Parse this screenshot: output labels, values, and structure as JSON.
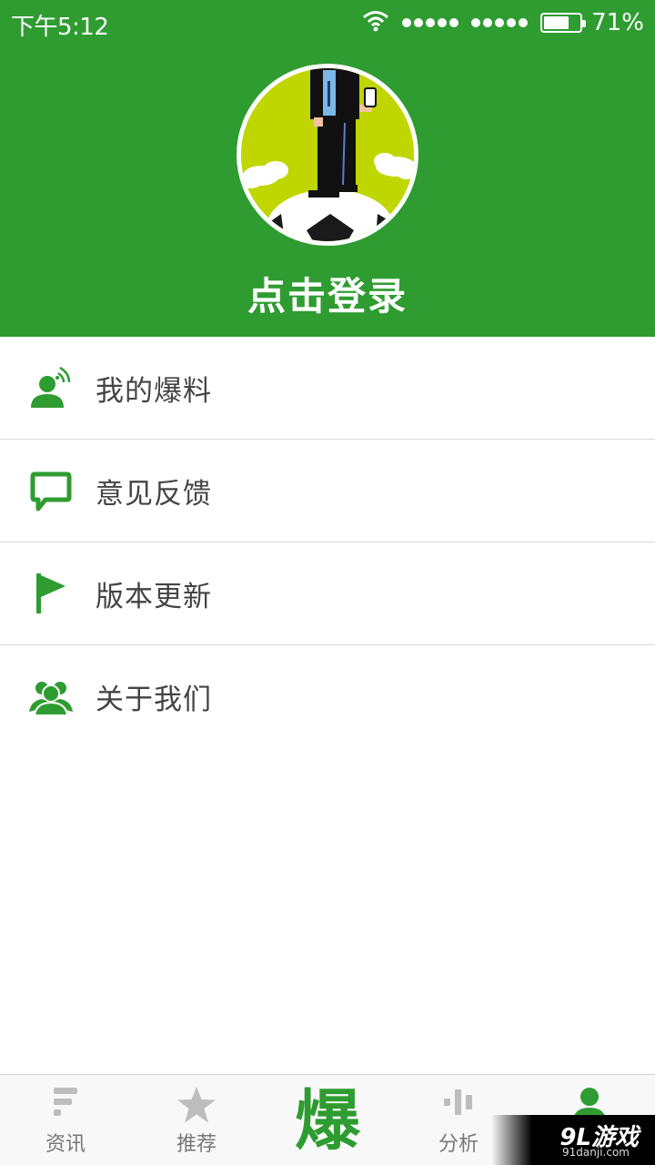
{
  "status_bar": {
    "time": "下午5:12",
    "battery_percent": "71%",
    "battery_level": 0.71
  },
  "profile": {
    "login_text": "点击登录"
  },
  "menu": {
    "items": [
      {
        "label": "我的爆料",
        "icon": "user-broadcast-icon"
      },
      {
        "label": "意见反馈",
        "icon": "speech-bubble-icon"
      },
      {
        "label": "版本更新",
        "icon": "flag-icon"
      },
      {
        "label": "关于我们",
        "icon": "group-icon"
      }
    ]
  },
  "tabbar": {
    "tabs": [
      {
        "label": "资讯",
        "icon": "news-icon",
        "active": false
      },
      {
        "label": "推荐",
        "icon": "star-icon",
        "active": false
      },
      {
        "label": "",
        "glyph": "爆",
        "active": false
      },
      {
        "label": "分析",
        "icon": "analysis-bars-icon",
        "active": false
      },
      {
        "label": "",
        "icon": "profile-icon",
        "active": true
      }
    ]
  },
  "watermark": {
    "main": "9L游戏",
    "sub": "91danji.com"
  },
  "colors": {
    "brand_green": "#2f9c31",
    "avatar_bg": "#c0d600",
    "tab_inactive": "#bdbdbd"
  }
}
